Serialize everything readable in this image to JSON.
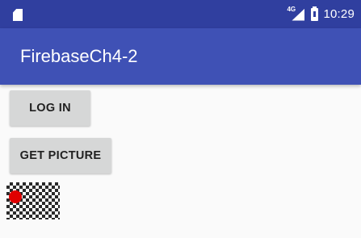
{
  "status_bar": {
    "network_type": "4G",
    "time": "10:29",
    "icons": [
      "sd-card-icon",
      "signal-icon",
      "battery-icon"
    ]
  },
  "app_bar": {
    "title": "FirebaseCh4-2"
  },
  "buttons": {
    "login_label": "LOG IN",
    "get_picture_label": "GET PICTURE"
  },
  "colors": {
    "status_bar": "#303f9f",
    "app_bar": "#3f51b5",
    "button": "#d6d7d7",
    "background": "#fafafa"
  }
}
